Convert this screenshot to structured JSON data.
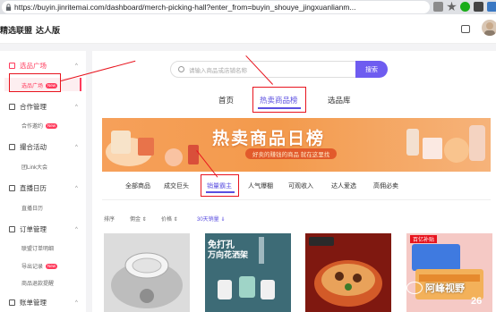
{
  "browser": {
    "url": "https://buyin.jinritemai.com/dashboard/merch-picking-hall?enter_from=buyin_shouye_jingxuanlianm..."
  },
  "header": {
    "brand": "精选联盟",
    "role": "达人版"
  },
  "sidebar": {
    "groups": [
      {
        "label": "选品广场",
        "items": [
          {
            "label": "选品广场",
            "badge": "New"
          }
        ]
      },
      {
        "label": "合作管理",
        "items": [
          {
            "label": "合作邀约",
            "badge": "New"
          }
        ]
      },
      {
        "label": "撮合活动",
        "items": [
          {
            "label": "团Link大会",
            "badge": ""
          }
        ]
      },
      {
        "label": "直播日历",
        "items": [
          {
            "label": "直播日历",
            "badge": ""
          }
        ]
      },
      {
        "label": "订单管理",
        "items": [
          {
            "label": "联盟订单明细",
            "badge": ""
          },
          {
            "label": "导出记录",
            "badge": "New"
          },
          {
            "label": "商品退款提醒",
            "badge": ""
          }
        ]
      },
      {
        "label": "账单管理",
        "items": []
      }
    ]
  },
  "search": {
    "placeholder": "请输入商品或店铺名称",
    "button": "搜索"
  },
  "main_tabs": [
    {
      "label": "首页"
    },
    {
      "label": "热卖商品榜"
    },
    {
      "label": "选品库"
    }
  ],
  "banner": {
    "title": "热卖商品日榜",
    "subtitle": "好卖的赚钱的商品 就在这里找"
  },
  "categories": [
    {
      "label": "全部商品"
    },
    {
      "label": "成交巨头"
    },
    {
      "label": "销量霸主"
    },
    {
      "label": "人气爆棚"
    },
    {
      "label": "可观收入"
    },
    {
      "label": "达人爱选"
    },
    {
      "label": "高佣必卖"
    }
  ],
  "sort": {
    "label": "排序",
    "options": [
      "佣金 ⇕",
      "价格 ⇕",
      "30天销量 ⇓"
    ]
  },
  "cards": [
    {
      "text1": "",
      "text2": ""
    },
    {
      "text1": "免打孔",
      "text2": "万向花洒架"
    },
    {
      "text1": "",
      "text2": ""
    },
    {
      "text1": "百亿补贴",
      "text2": "26"
    }
  ],
  "watermark": "阿峰视野"
}
